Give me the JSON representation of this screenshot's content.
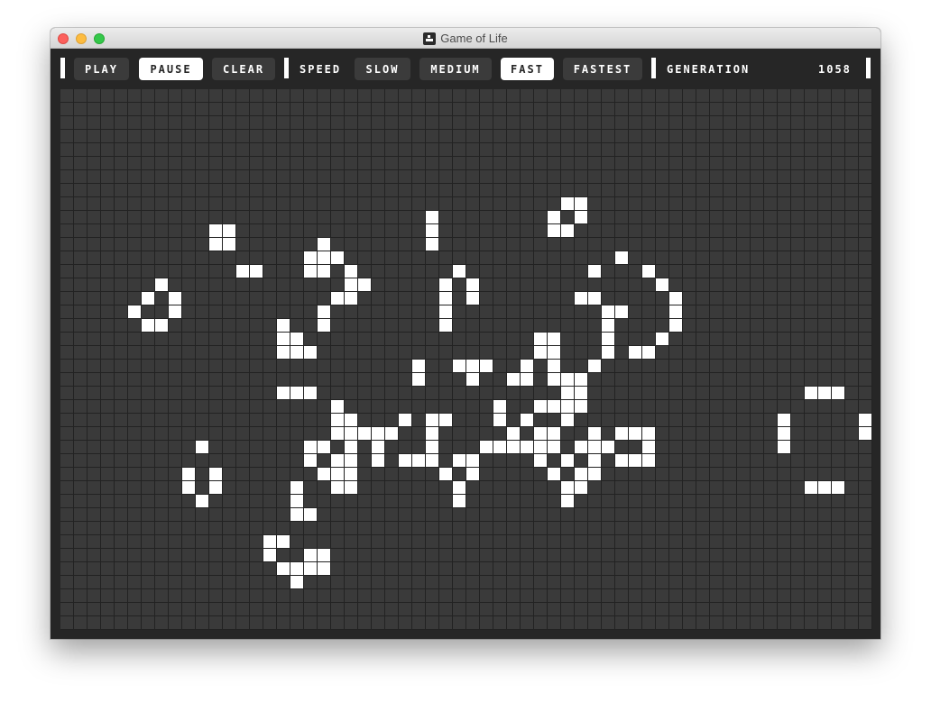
{
  "window": {
    "title": "Game of Life"
  },
  "toolbar": {
    "play_label": "PLAY",
    "pause_label": "PAUSE",
    "clear_label": "CLEAR",
    "speed_label": "SPEED",
    "speeds": [
      "SLOW",
      "MEDIUM",
      "FAST",
      "FASTEST"
    ],
    "selected_speed": "FAST",
    "state": "paused",
    "generation_label": "GENERATION",
    "generation_value": "1058"
  },
  "colors": {
    "background": "#262626",
    "dead_cell": "#3a3a3a",
    "alive_cell": "#ffffff",
    "active_button": "#ffffff",
    "inactive_button": "#3b3b3b"
  },
  "board": {
    "columns": 60,
    "rows": 40,
    "live_cells": [
      [
        37,
        8
      ],
      [
        38,
        8
      ],
      [
        27,
        9
      ],
      [
        36,
        9
      ],
      [
        38,
        9
      ],
      [
        11,
        10
      ],
      [
        12,
        10
      ],
      [
        27,
        10
      ],
      [
        36,
        10
      ],
      [
        37,
        10
      ],
      [
        11,
        11
      ],
      [
        12,
        11
      ],
      [
        19,
        11
      ],
      [
        27,
        11
      ],
      [
        18,
        12
      ],
      [
        19,
        12
      ],
      [
        20,
        12
      ],
      [
        41,
        12
      ],
      [
        13,
        13
      ],
      [
        14,
        13
      ],
      [
        18,
        13
      ],
      [
        19,
        13
      ],
      [
        21,
        13
      ],
      [
        29,
        13
      ],
      [
        39,
        13
      ],
      [
        43,
        13
      ],
      [
        7,
        14
      ],
      [
        21,
        14
      ],
      [
        22,
        14
      ],
      [
        28,
        14
      ],
      [
        30,
        14
      ],
      [
        44,
        14
      ],
      [
        6,
        15
      ],
      [
        8,
        15
      ],
      [
        20,
        15
      ],
      [
        21,
        15
      ],
      [
        28,
        15
      ],
      [
        30,
        15
      ],
      [
        38,
        15
      ],
      [
        39,
        15
      ],
      [
        45,
        15
      ],
      [
        5,
        16
      ],
      [
        8,
        16
      ],
      [
        19,
        16
      ],
      [
        28,
        16
      ],
      [
        40,
        16
      ],
      [
        41,
        16
      ],
      [
        45,
        16
      ],
      [
        6,
        17
      ],
      [
        7,
        17
      ],
      [
        16,
        17
      ],
      [
        19,
        17
      ],
      [
        28,
        17
      ],
      [
        40,
        17
      ],
      [
        45,
        17
      ],
      [
        16,
        18
      ],
      [
        17,
        18
      ],
      [
        35,
        18
      ],
      [
        36,
        18
      ],
      [
        40,
        18
      ],
      [
        44,
        18
      ],
      [
        16,
        19
      ],
      [
        17,
        19
      ],
      [
        18,
        19
      ],
      [
        35,
        19
      ],
      [
        36,
        19
      ],
      [
        40,
        19
      ],
      [
        42,
        19
      ],
      [
        43,
        19
      ],
      [
        26,
        20
      ],
      [
        29,
        20
      ],
      [
        30,
        20
      ],
      [
        31,
        20
      ],
      [
        34,
        20
      ],
      [
        36,
        20
      ],
      [
        39,
        20
      ],
      [
        26,
        21
      ],
      [
        30,
        21
      ],
      [
        33,
        21
      ],
      [
        34,
        21
      ],
      [
        36,
        21
      ],
      [
        37,
        21
      ],
      [
        38,
        21
      ],
      [
        16,
        22
      ],
      [
        17,
        22
      ],
      [
        18,
        22
      ],
      [
        37,
        22
      ],
      [
        38,
        22
      ],
      [
        55,
        22
      ],
      [
        56,
        22
      ],
      [
        57,
        22
      ],
      [
        20,
        23
      ],
      [
        32,
        23
      ],
      [
        35,
        23
      ],
      [
        36,
        23
      ],
      [
        37,
        23
      ],
      [
        38,
        23
      ],
      [
        20,
        24
      ],
      [
        21,
        24
      ],
      [
        25,
        24
      ],
      [
        27,
        24
      ],
      [
        28,
        24
      ],
      [
        32,
        24
      ],
      [
        34,
        24
      ],
      [
        37,
        24
      ],
      [
        53,
        24
      ],
      [
        59,
        24
      ],
      [
        20,
        25
      ],
      [
        21,
        25
      ],
      [
        22,
        25
      ],
      [
        23,
        25
      ],
      [
        24,
        25
      ],
      [
        27,
        25
      ],
      [
        33,
        25
      ],
      [
        35,
        25
      ],
      [
        36,
        25
      ],
      [
        39,
        25
      ],
      [
        41,
        25
      ],
      [
        42,
        25
      ],
      [
        43,
        25
      ],
      [
        53,
        25
      ],
      [
        59,
        25
      ],
      [
        10,
        26
      ],
      [
        18,
        26
      ],
      [
        19,
        26
      ],
      [
        21,
        26
      ],
      [
        23,
        26
      ],
      [
        27,
        26
      ],
      [
        31,
        26
      ],
      [
        32,
        26
      ],
      [
        33,
        26
      ],
      [
        34,
        26
      ],
      [
        35,
        26
      ],
      [
        36,
        26
      ],
      [
        38,
        26
      ],
      [
        39,
        26
      ],
      [
        40,
        26
      ],
      [
        43,
        26
      ],
      [
        53,
        26
      ],
      [
        18,
        27
      ],
      [
        20,
        27
      ],
      [
        21,
        27
      ],
      [
        23,
        27
      ],
      [
        25,
        27
      ],
      [
        26,
        27
      ],
      [
        27,
        27
      ],
      [
        29,
        27
      ],
      [
        30,
        27
      ],
      [
        35,
        27
      ],
      [
        37,
        27
      ],
      [
        39,
        27
      ],
      [
        41,
        27
      ],
      [
        42,
        27
      ],
      [
        43,
        27
      ],
      [
        9,
        28
      ],
      [
        11,
        28
      ],
      [
        19,
        28
      ],
      [
        20,
        28
      ],
      [
        21,
        28
      ],
      [
        28,
        28
      ],
      [
        30,
        28
      ],
      [
        36,
        28
      ],
      [
        38,
        28
      ],
      [
        39,
        28
      ],
      [
        9,
        29
      ],
      [
        11,
        29
      ],
      [
        17,
        29
      ],
      [
        20,
        29
      ],
      [
        21,
        29
      ],
      [
        29,
        29
      ],
      [
        37,
        29
      ],
      [
        38,
        29
      ],
      [
        55,
        29
      ],
      [
        56,
        29
      ],
      [
        57,
        29
      ],
      [
        10,
        30
      ],
      [
        17,
        30
      ],
      [
        29,
        30
      ],
      [
        37,
        30
      ],
      [
        17,
        31
      ],
      [
        18,
        31
      ],
      [
        15,
        33
      ],
      [
        16,
        33
      ],
      [
        15,
        34
      ],
      [
        18,
        34
      ],
      [
        19,
        34
      ],
      [
        16,
        35
      ],
      [
        17,
        35
      ],
      [
        18,
        35
      ],
      [
        19,
        35
      ],
      [
        17,
        36
      ]
    ]
  }
}
